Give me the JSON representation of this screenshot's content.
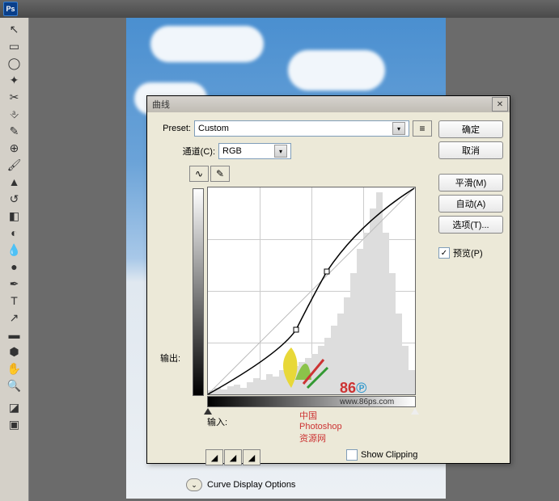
{
  "app": {
    "name": "Ps"
  },
  "dialog": {
    "title": "曲线",
    "close": "✕",
    "preset_label": "Preset:",
    "preset_value": "Custom",
    "channel_label": "通道(C):",
    "channel_value": "RGB",
    "output_label": "输出:",
    "input_label": "输入:",
    "show_clipping": "Show Clipping",
    "display_options": "Curve Display Options",
    "buttons": {
      "ok": "确定",
      "cancel": "取消",
      "smooth": "平滑(M)",
      "auto": "自动(A)",
      "options": "选项(T)..."
    },
    "preview_label": "预览(P)",
    "preview_checked": "✓"
  },
  "watermark": {
    "brand": "86",
    "url": "www.86ps.com",
    "tagline": "中国Photoshop资源网"
  },
  "chart_data": {
    "type": "line",
    "title": "曲线",
    "xlabel": "输入",
    "ylabel": "输出",
    "xlim": [
      0,
      255
    ],
    "ylim": [
      0,
      255
    ],
    "control_points": [
      {
        "x": 0,
        "y": 0
      },
      {
        "x": 109,
        "y": 80
      },
      {
        "x": 147,
        "y": 152
      },
      {
        "x": 255,
        "y": 255
      }
    ],
    "histogram_peaks": [
      5,
      8,
      6,
      10,
      12,
      8,
      15,
      20,
      18,
      25,
      22,
      30,
      28,
      35,
      40,
      45,
      50,
      60,
      70,
      85,
      100,
      120,
      150,
      180,
      200,
      230,
      250,
      200,
      150,
      100,
      60,
      30
    ]
  }
}
